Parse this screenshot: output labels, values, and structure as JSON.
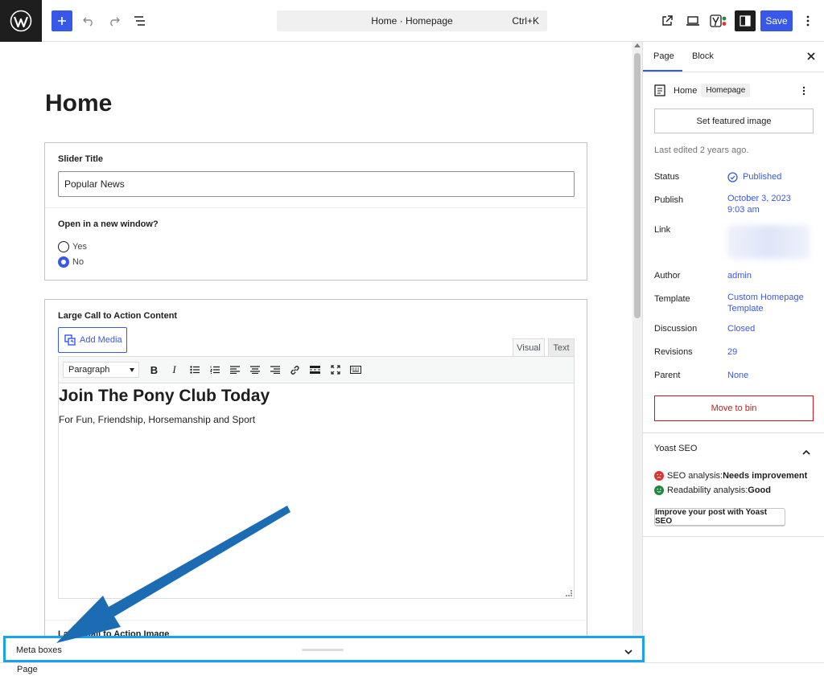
{
  "toolbar": {
    "command_title": "Home · Homepage",
    "command_shortcut": "Ctrl+K",
    "save_label": "Save"
  },
  "editor": {
    "page_title": "Home",
    "slider_box": {
      "title_label": "Slider Title",
      "title_value": "Popular News",
      "window_label": "Open in a new window?",
      "options": [
        "Yes",
        "No"
      ],
      "selected": "No"
    },
    "cta_box": {
      "label": "Large Call to Action Content",
      "add_media_label": "Add Media",
      "tab_visual": "Visual",
      "tab_text": "Text",
      "format_value": "Paragraph",
      "heading": "Join The Pony Club Today",
      "paragraph": "For Fun, Friendship, Horsemanship and Sport",
      "next_label": "Large Call to Action Image"
    }
  },
  "meta_bar": {
    "label": "Meta boxes"
  },
  "footer": {
    "breadcrumb": "Page"
  },
  "sidebar": {
    "tabs": [
      "Page",
      "Block"
    ],
    "page_name": "Home",
    "page_chip": "Homepage",
    "featured_button": "Set featured image",
    "last_edited": "Last edited 2 years ago.",
    "rows": {
      "status_key": "Status",
      "status_val": "Published",
      "publish_key": "Publish",
      "publish_val_1": "October 3, 2023",
      "publish_val_2": "9:03 am",
      "link_key": "Link",
      "author_key": "Author",
      "author_val": "admin",
      "template_key": "Template",
      "template_val_1": "Custom Homepage",
      "template_val_2": "Template",
      "discussion_key": "Discussion",
      "discussion_val": "Closed",
      "revisions_key": "Revisions",
      "revisions_val": "29",
      "parent_key": "Parent",
      "parent_val": "None"
    },
    "bin_button": "Move to bin",
    "yoast": {
      "title": "Yoast SEO",
      "seo_label": "SEO analysis: ",
      "seo_value": "Needs improvement",
      "read_label": "Readability analysis: ",
      "read_value": "Good",
      "button": "Improve your post with Yoast SEO"
    }
  },
  "colors": {
    "accent": "#3858e9",
    "highlight": "#1aa3ea",
    "arrow": "#1c6cb4",
    "danger": "#cc1818"
  }
}
